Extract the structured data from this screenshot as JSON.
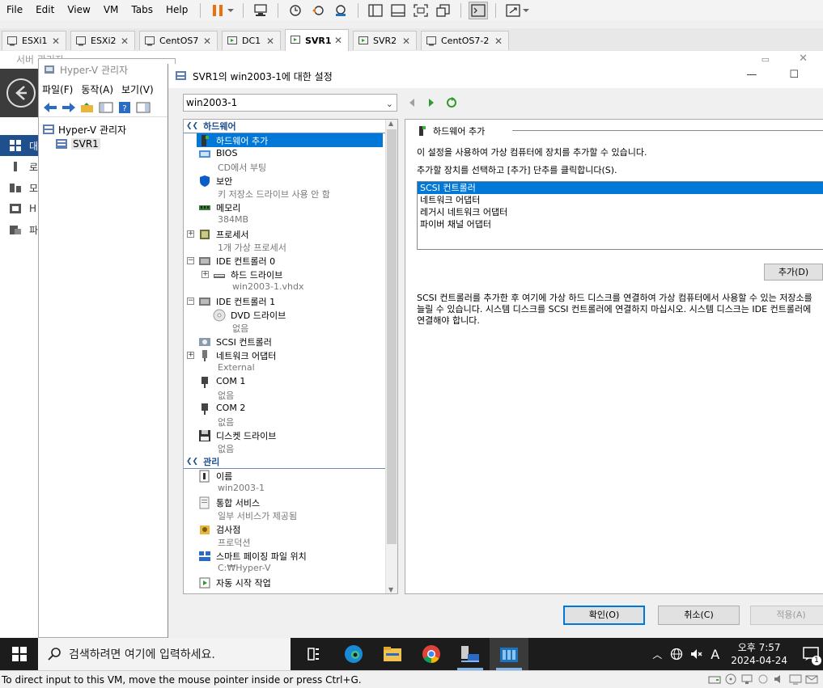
{
  "menu": [
    "File",
    "Edit",
    "View",
    "VM",
    "Tabs",
    "Help"
  ],
  "tabs": [
    {
      "label": "ESXi1",
      "active": false
    },
    {
      "label": "ESXi2",
      "active": false
    },
    {
      "label": "CentOS7",
      "active": false
    },
    {
      "label": "DC1",
      "active": false
    },
    {
      "label": "SVR1",
      "active": true
    },
    {
      "label": "SVR2",
      "active": false
    },
    {
      "label": "CentOS7-2",
      "active": false
    }
  ],
  "server_manager": {
    "title": "서버 관리자",
    "side_items": [
      "대",
      "로",
      "모",
      "H",
      "파"
    ]
  },
  "hyperv": {
    "title": "Hyper-V 관리자",
    "menu": [
      "파일(F)",
      "동작(A)",
      "보기(V)"
    ],
    "tree_root": "Hyper-V 관리자",
    "tree_child": "SVR1"
  },
  "dialog": {
    "title": "SVR1의 win2003-1에 대한 설정",
    "vm_selected": "win2003-1",
    "section_hardware": "하드웨어",
    "section_manage": "관리",
    "hardware_items": [
      {
        "label": "하드웨어 추가",
        "sub": ""
      },
      {
        "label": "BIOS",
        "sub": "CD에서 부팅"
      },
      {
        "label": "보안",
        "sub": "키 저장소 드라이브 사용 안 함"
      },
      {
        "label": "메모리",
        "sub": "384MB"
      },
      {
        "label": "프로세서",
        "sub": "1개 가상 프로세서"
      },
      {
        "label": "IDE 컨트롤러 0",
        "sub": ""
      },
      {
        "label": "하드 드라이브",
        "sub": "win2003-1.vhdx"
      },
      {
        "label": "IDE 컨트롤러 1",
        "sub": ""
      },
      {
        "label": "DVD 드라이브",
        "sub": "없음"
      },
      {
        "label": "SCSI 컨트롤러",
        "sub": ""
      },
      {
        "label": "네트워크 어댑터",
        "sub": "External"
      },
      {
        "label": "COM 1",
        "sub": "없음"
      },
      {
        "label": "COM 2",
        "sub": "없음"
      },
      {
        "label": "디스켓 드라이브",
        "sub": "없음"
      }
    ],
    "manage_items": [
      {
        "label": "이름",
        "sub": "win2003-1"
      },
      {
        "label": "통합 서비스",
        "sub": "일부 서비스가 제공됨"
      },
      {
        "label": "검사점",
        "sub": "프로덕션"
      },
      {
        "label": "스마트 페이징 파일 위치",
        "sub": "C:₩Hyper-V"
      },
      {
        "label": "자동 시작 작업",
        "sub": ""
      }
    ],
    "right": {
      "heading": "하드웨어 추가",
      "line1": "이 설정을 사용하여 가상 컴퓨터에 장치를 추가할 수 있습니다.",
      "line2": "추가할 장치를 선택하고 [추가] 단추를 클릭합니다(S).",
      "devices": [
        "SCSI 컨트롤러",
        "네트워크 어댑터",
        "레거시 네트워크 어댑터",
        "파이버 채널 어댑터"
      ],
      "add_button": "추가(D)",
      "description": "SCSI 컨트롤러를 추가한 후 여기에 가상 하드 디스크를 연결하여 가상 컴퓨터에서 사용할 수 있는 저장소를 늘릴 수 있습니다. 시스템 디스크를 SCSI 컨트롤러에 연결하지 마십시오. 시스템 디스크는 IDE 컨트롤러에 연결해야 합니다."
    },
    "buttons": {
      "ok": "확인(O)",
      "cancel": "취소(C)",
      "apply": "적용(A)"
    }
  },
  "taskbar": {
    "search_placeholder": "검색하려면 여기에 입력하세요.",
    "ime": "A",
    "time": "오후 7:57",
    "date": "2024-04-24",
    "notification_count": "1"
  },
  "status_text": "To direct input to this VM, move the mouse pointer inside or press Ctrl+G.",
  "colors": {
    "accent": "#0078d7",
    "pause": "#e8730c",
    "header_blue": "#1e4e8c"
  }
}
